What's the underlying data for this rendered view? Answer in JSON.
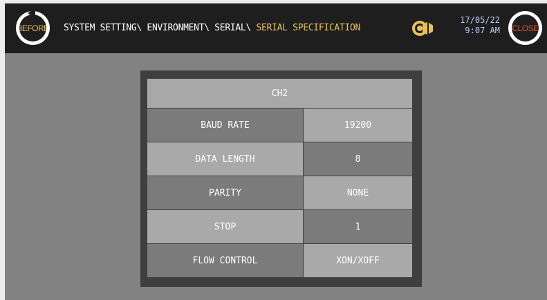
{
  "header": {
    "before_label": "BEFORE",
    "close_label": "CLOSE",
    "path": "SYSTEM SETTING\\ ENVIRONMENT\\ SERIAL\\",
    "current": "SERIAL SPECIFICATION",
    "date": "17/05/22",
    "time": "9:07 AM",
    "speaker_icon": "speaker-icon"
  },
  "panel": {
    "title": "CH2",
    "rows": [
      {
        "label": "BAUD RATE",
        "value": "19200"
      },
      {
        "label": "DATA LENGTH",
        "value": "8"
      },
      {
        "label": "PARITY",
        "value": "NONE"
      },
      {
        "label": "STOP",
        "value": "1"
      },
      {
        "label": "FLOW CONTROL",
        "value": "XON/XOFF"
      }
    ]
  },
  "colors": {
    "header_bg": "#1e1e1e",
    "body_bg": "#828282",
    "accent_yellow": "#e8c257",
    "close_red": "#e0553a",
    "datetime": "#c9c9ff"
  }
}
